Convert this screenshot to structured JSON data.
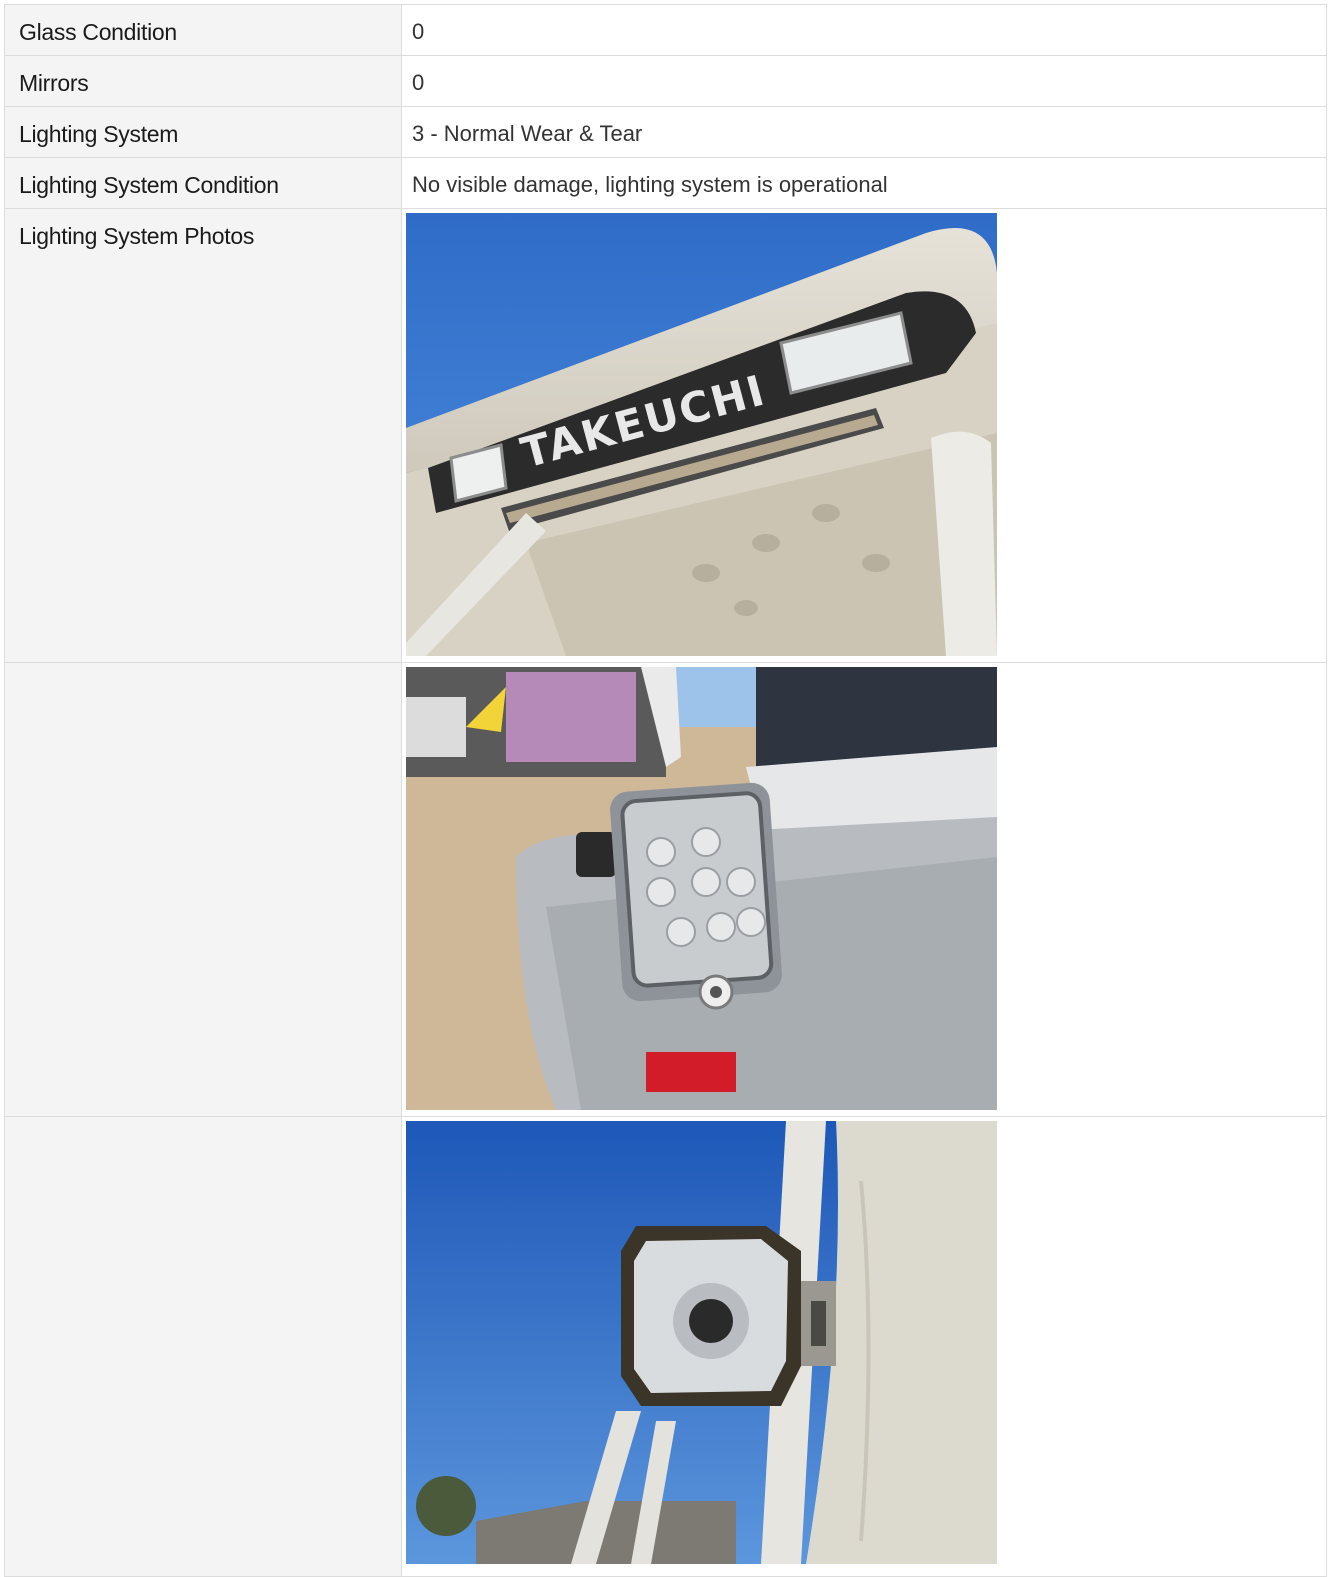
{
  "rows": [
    {
      "label": "Glass Condition",
      "value": "0"
    },
    {
      "label": "Mirrors",
      "value": "0"
    },
    {
      "label": "Lighting System",
      "value": "3 - Normal Wear & Tear"
    },
    {
      "label": "Lighting System Condition",
      "value": "No visible damage, lighting system is operational"
    }
  ],
  "photos_section": {
    "label": "Lighting System Photos",
    "photo_1_logo_text": "TAKEUCHI"
  },
  "colors": {
    "label_bg": "#f4f4f4",
    "border": "#dcdcdc",
    "sky": "#3a78d0"
  }
}
